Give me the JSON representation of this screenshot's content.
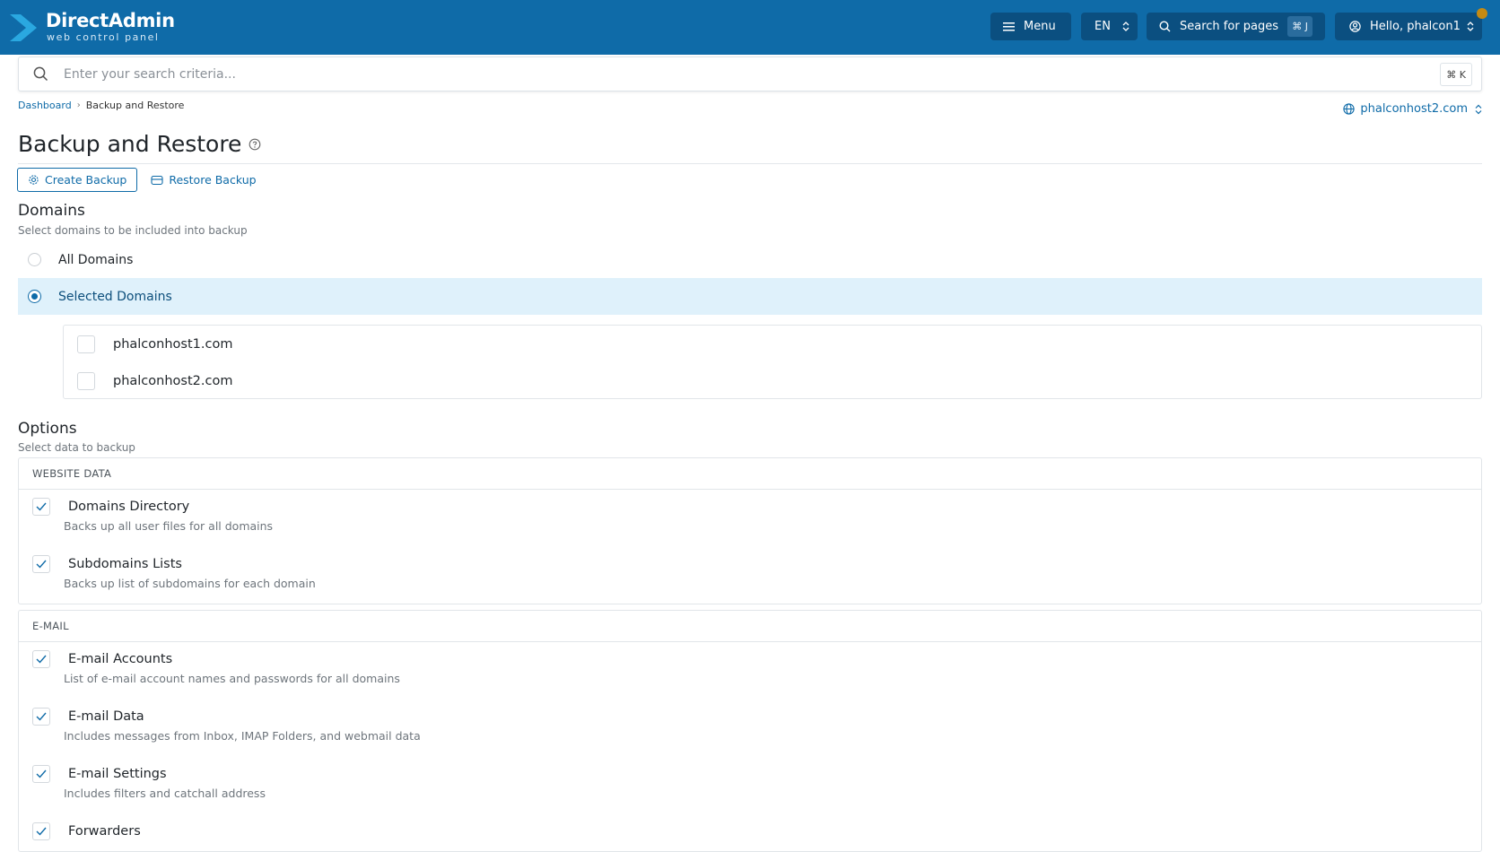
{
  "header": {
    "brand_title": "DirectAdmin",
    "brand_subtitle": "web control panel",
    "menu_label": "Menu",
    "language": "EN",
    "search_pages_label": "Search for pages",
    "search_pages_shortcut": "⌘ J",
    "user_greeting": "Hello, phalcon1"
  },
  "search": {
    "placeholder": "Enter your search criteria...",
    "shortcut": "⌘ K"
  },
  "breadcrumb": {
    "home": "Dashboard",
    "current": "Backup and Restore"
  },
  "domain_selector": {
    "value": "phalconhost2.com"
  },
  "page": {
    "title": "Backup and Restore"
  },
  "tabs": [
    {
      "label": "Create Backup",
      "active": true
    },
    {
      "label": "Restore Backup",
      "active": false
    }
  ],
  "domains_section": {
    "title": "Domains",
    "subtitle": "Select domains to be included into backup",
    "options": [
      {
        "label": "All Domains",
        "selected": false
      },
      {
        "label": "Selected Domains",
        "selected": true
      }
    ],
    "domain_list": [
      {
        "name": "phalconhost1.com",
        "checked": false
      },
      {
        "name": "phalconhost2.com",
        "checked": false
      }
    ]
  },
  "options_section": {
    "title": "Options",
    "subtitle": "Select data to backup",
    "groups": [
      {
        "heading": "WEBSITE DATA",
        "items": [
          {
            "label": "Domains Directory",
            "desc": "Backs up all user files for all domains",
            "checked": true
          },
          {
            "label": "Subdomains Lists",
            "desc": "Backs up list of subdomains for each domain",
            "checked": true
          }
        ]
      },
      {
        "heading": "E-MAIL",
        "items": [
          {
            "label": "E-mail Accounts",
            "desc": "List of e-mail account names and passwords for all domains",
            "checked": true
          },
          {
            "label": "E-mail Data",
            "desc": "Includes messages from Inbox, IMAP Folders, and webmail data",
            "checked": true
          },
          {
            "label": "E-mail Settings",
            "desc": "Includes filters and catchall address",
            "checked": true
          },
          {
            "label": "Forwarders",
            "desc": "",
            "checked": true
          }
        ]
      }
    ]
  },
  "colors": {
    "brand_blue": "#0f6ba8",
    "selected_row_bg": "#dff1fb",
    "notification_dot": "#c58a12"
  }
}
